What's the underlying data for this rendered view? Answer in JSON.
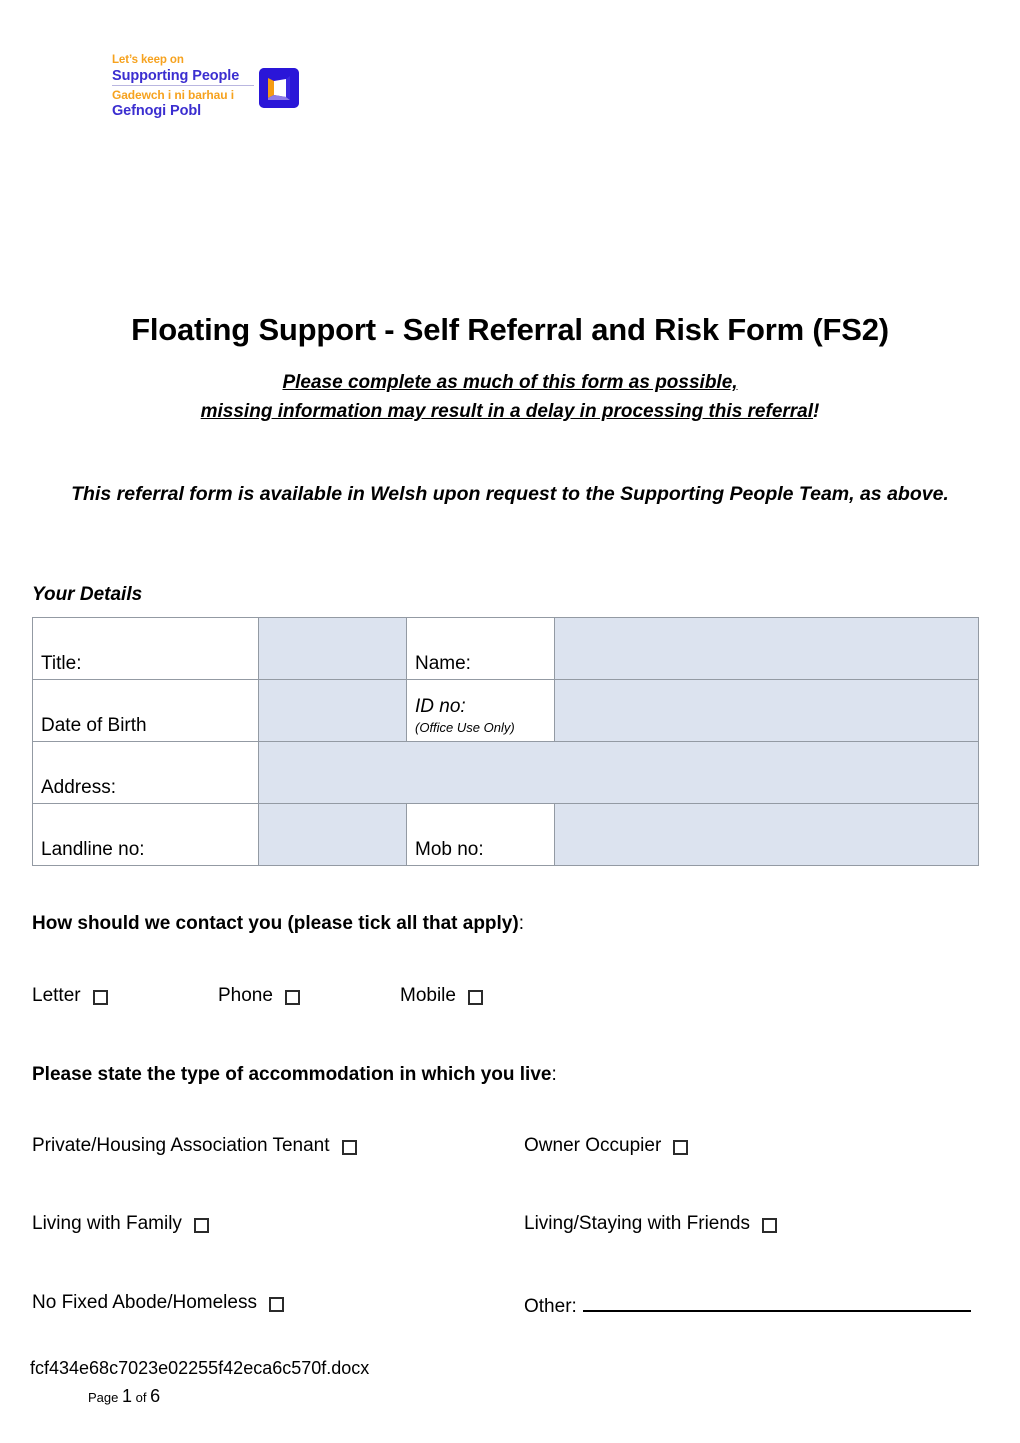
{
  "logo": {
    "line1": "Let’s keep on",
    "line2_a": "Supporting ",
    "line2_b": "People",
    "line3": "Gadewch i ni barhau i",
    "line4_a": "Gefnogi ",
    "line4_b": "Pobl",
    "icon": "open-door-icon",
    "colors": {
      "orange": "#f6a21e",
      "blue": "#3b2ed0",
      "mark_bg": "#2a16d8"
    }
  },
  "title": "Floating Support - Self Referral and Risk Form (FS2)",
  "subtitle": {
    "line1": "Please complete as much of this form as possible,",
    "line2_underlined": "missing information may result in a delay in processing this referral",
    "line2_tail": "!"
  },
  "welsh_note": "This referral form is available in Welsh upon request to the Supporting People Team, as above.",
  "your_details": {
    "heading": "Your Details",
    "rows": [
      {
        "label_left": "Title:",
        "label_mid": "Name:",
        "mid_sub": ""
      },
      {
        "label_left": "Date of Birth",
        "label_mid": "ID no:",
        "mid_sub": "(Office Use Only)"
      },
      {
        "label_left": "Address:"
      },
      {
        "label_left": "Landline no:",
        "label_mid": "Mob no:"
      }
    ],
    "fill_color": "#dce3ef",
    "border_color": "#939aa3"
  },
  "contact": {
    "question_bold": "How should we contact you (please tick all that apply)",
    "question_tail": ":",
    "options": [
      {
        "label": "Letter",
        "checked": false
      },
      {
        "label": "Phone",
        "checked": false
      },
      {
        "label": "Mobile",
        "checked": false
      }
    ]
  },
  "accommodation": {
    "question_bold": "Please state the type of accommodation in which you live",
    "question_tail": ":",
    "options": [
      {
        "label": "Private/Housing Association Tenant",
        "checked": false
      },
      {
        "label": "Owner Occupier",
        "checked": false
      },
      {
        "label": "Living with Family",
        "checked": false
      },
      {
        "label": "Living/Staying with Friends",
        "checked": false
      },
      {
        "label": "No Fixed Abode/Homeless",
        "checked": false
      }
    ],
    "other_label": "Other:",
    "other_value": ""
  },
  "footer": {
    "filename": "fcf434e68c7023e02255f42eca6c570f.docx",
    "page_word": "Page ",
    "page_number": "1",
    "of_word": " of ",
    "page_total": "6"
  }
}
